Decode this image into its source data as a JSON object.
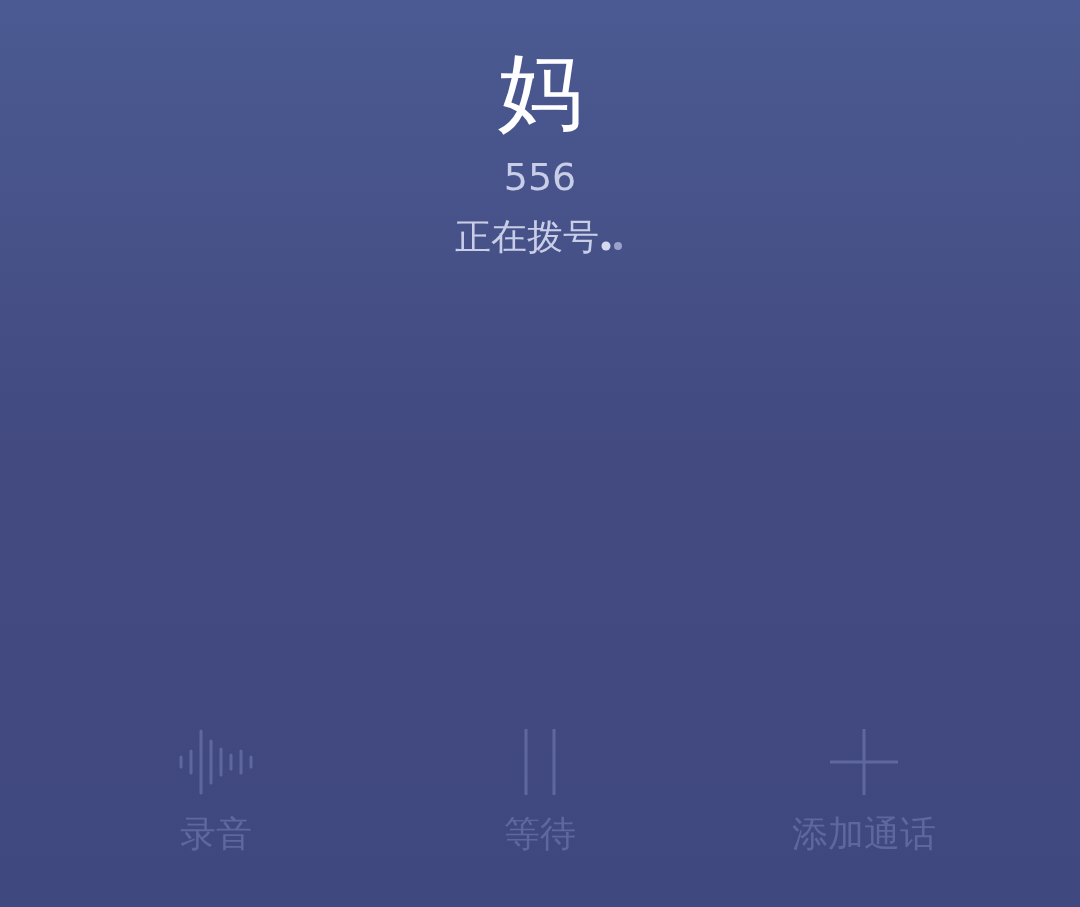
{
  "contact": {
    "name": "妈",
    "number": "556",
    "status": "正在拨号"
  },
  "controls": [
    {
      "kind": "record",
      "label": "录音",
      "disabled": true
    },
    {
      "kind": "hold",
      "label": "等待",
      "disabled": true
    },
    {
      "kind": "add",
      "label": "添加通话",
      "disabled": true
    }
  ]
}
